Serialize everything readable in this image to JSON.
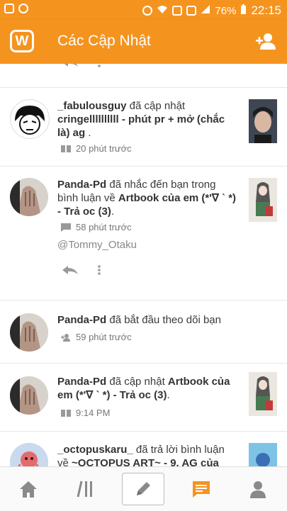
{
  "status_bar": {
    "battery": "76%",
    "time": "22:15"
  },
  "app_bar": {
    "logo": "W",
    "title": "Các Cập Nhật",
    "add_user_icon": "add-person-icon"
  },
  "notifications": [
    {
      "user": "_fabulousguy",
      "action": " đã cập nhật ",
      "target": "cringellllllllll - phút pr + mở (chắc là) ag",
      "tail": " .",
      "time_icon": "book-icon",
      "time": "20 phút trước"
    },
    {
      "user": "Panda-Pd",
      "action": " đã nhắc đến bạn trong bình luận về ",
      "target": "Artbook của em (*'∇ ` *) - Trả oc (3)",
      "tail": ".",
      "time_icon": "comment-icon",
      "time": "58 phút trước",
      "mention": "@Tommy_Otaku"
    },
    {
      "user": "Panda-Pd",
      "action": " đã bắt đầu theo dõi bạn",
      "target": "",
      "tail": "",
      "time_icon": "follow-icon",
      "time": "59 phút trước"
    },
    {
      "user": "Panda-Pd",
      "action": " đã cập nhật ",
      "target": "Artbook của em (*'∇ ` *) - Trả oc (3)",
      "tail": ".",
      "time_icon": "book-icon",
      "time": "9:14 PM"
    },
    {
      "user": "_octopuskaru_",
      "action": " đã trả lời bình luận về ",
      "target": "~OCTOPUS ART~ - 9. AG của",
      "tail": ""
    }
  ],
  "bottom_nav": [
    "home-icon",
    "library-icon",
    "write-icon",
    "notifications-icon",
    "profile-icon"
  ],
  "colors": {
    "accent": "#f5931f",
    "nav_active": "#f5931f",
    "nav_inactive": "#8a8a8a"
  }
}
